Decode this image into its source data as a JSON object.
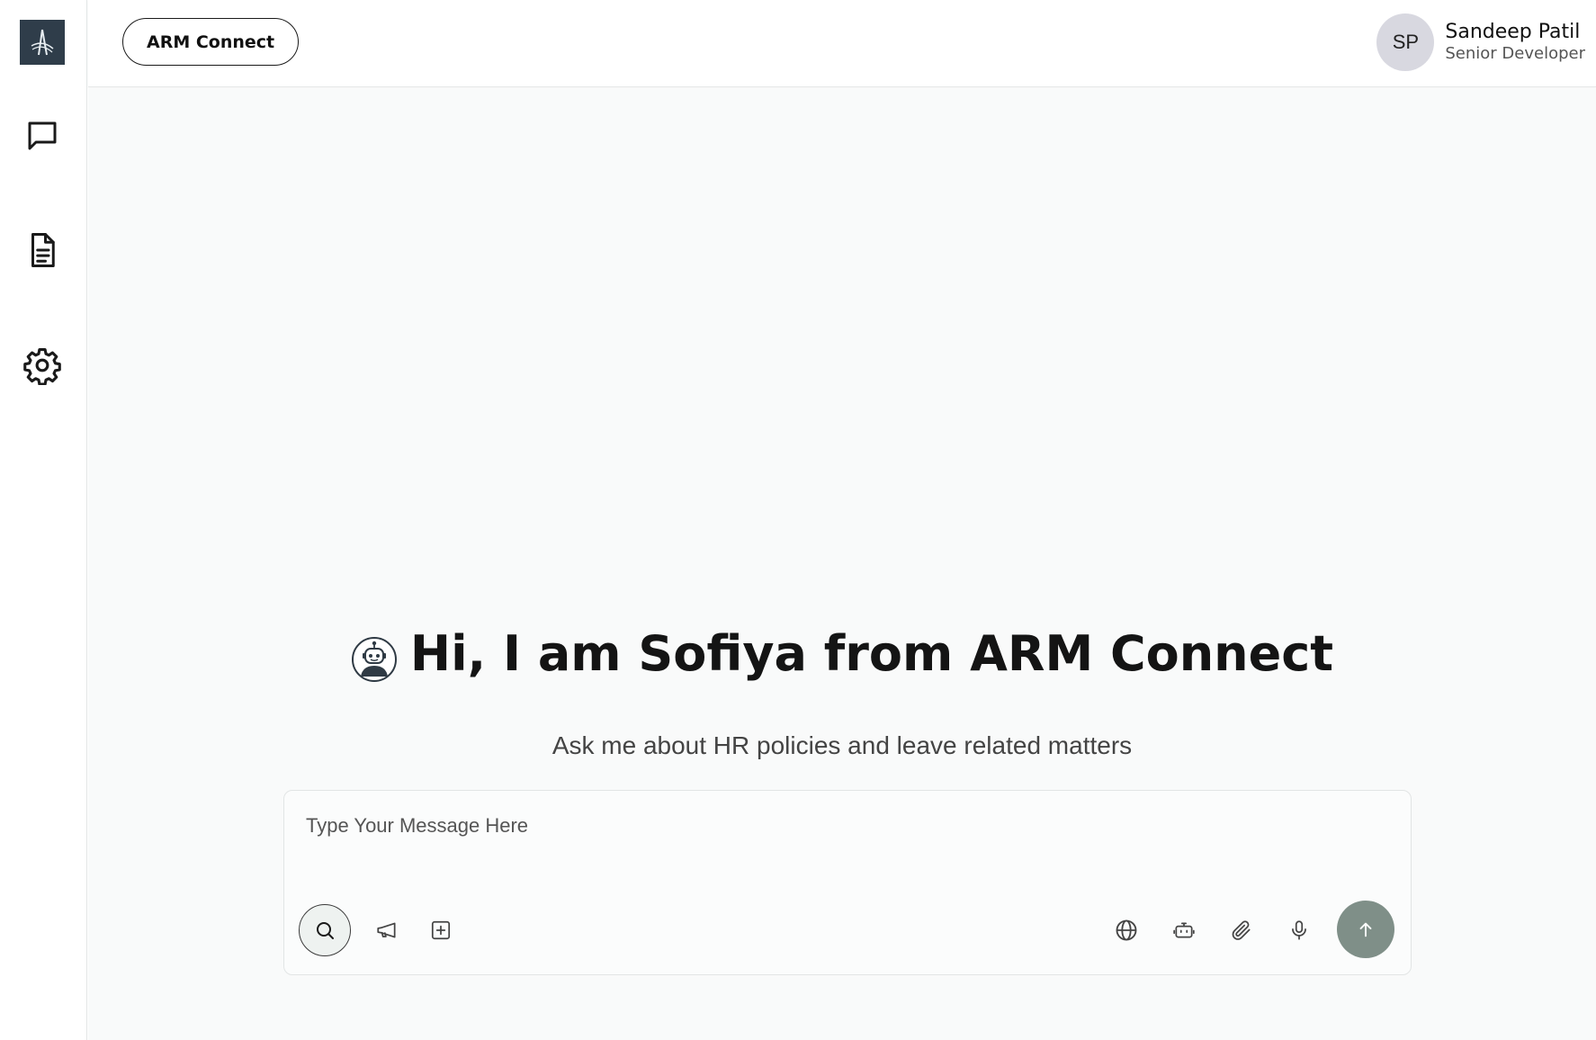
{
  "app": {
    "logo_alt": "ARM logo",
    "header_button": "ARM Connect"
  },
  "sidebar": {
    "items": [
      {
        "name": "chat",
        "icon": "chat-bubble-icon"
      },
      {
        "name": "documents",
        "icon": "document-icon"
      },
      {
        "name": "settings",
        "icon": "gear-icon"
      }
    ]
  },
  "user": {
    "initials": "SP",
    "name": "Sandeep Patil",
    "role": "Senior Developer"
  },
  "hero": {
    "title": "Hi, I am Sofiya from ARM Connect",
    "subtitle": "Ask me about HR policies and leave related matters",
    "bot_icon": "robot-avatar-icon"
  },
  "composer": {
    "placeholder": "Type Your Message Here",
    "left_tools": [
      "search-icon",
      "megaphone-icon",
      "add-square-icon"
    ],
    "right_tools": [
      "globe-icon",
      "bot-icon",
      "paperclip-icon",
      "microphone-icon"
    ],
    "send_icon": "arrow-up-icon"
  },
  "colors": {
    "logo_bg": "#2f3d4a",
    "main_bg": "#f9fafa",
    "send_bg": "#7f8f88",
    "avatar_bg": "#d8d8e0"
  }
}
